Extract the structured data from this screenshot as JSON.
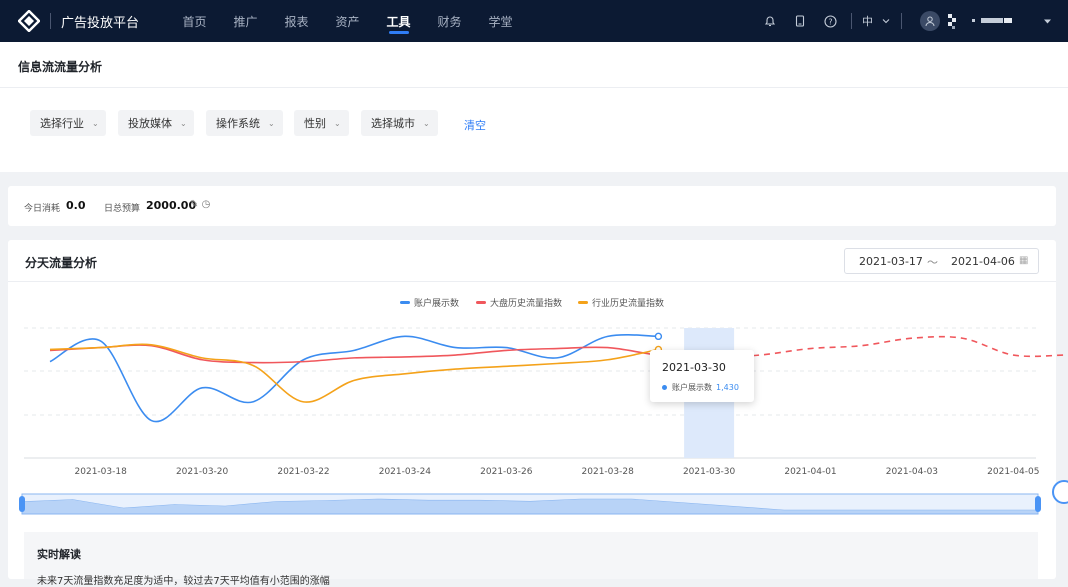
{
  "header": {
    "brand": "广告投放平台",
    "nav": [
      "首页",
      "推广",
      "报表",
      "资产",
      "工具",
      "财务",
      "学堂"
    ],
    "active_nav": "工具",
    "lang": "中",
    "icons": [
      "bell-icon",
      "tablet-icon",
      "help-icon",
      "user-icon",
      "caret-down-icon"
    ]
  },
  "page": {
    "title": "信息流流量分析"
  },
  "filters": {
    "items": [
      "选择行业",
      "投放媒体",
      "操作系统",
      "性别",
      "选择城市"
    ],
    "clear_label": "清空"
  },
  "budget": {
    "today_label": "今日消耗",
    "today_value": "0.0",
    "daily_label": "日总预算",
    "daily_value": "2000.00"
  },
  "card": {
    "title": "分天流量分析",
    "date_start": "2021-03-17",
    "date_sep": "〜",
    "date_end": "2021-04-06"
  },
  "tooltip": {
    "date": "2021-03-30",
    "label": "账户展示数",
    "value": "1,430"
  },
  "insight": {
    "title": "实时解读",
    "text": "未来7天流量指数充足度为适中，较过去7天平均值有小范围的涨幅"
  },
  "colors": {
    "blue": "#3b8cf0",
    "red": "#f0575c",
    "orange": "#f4a21a",
    "accent": "#2f7df6"
  },
  "chart_data": {
    "type": "line",
    "x": [
      "2021-03-17",
      "2021-03-18",
      "2021-03-19",
      "2021-03-20",
      "2021-03-21",
      "2021-03-22",
      "2021-03-23",
      "2021-03-24",
      "2021-03-25",
      "2021-03-26",
      "2021-03-27",
      "2021-03-28",
      "2021-03-29",
      "2021-03-30",
      "2021-03-31",
      "2021-04-01",
      "2021-04-02",
      "2021-04-03",
      "2021-04-04",
      "2021-04-05",
      "2021-04-06"
    ],
    "x_tick_labels": [
      "2021-03-18",
      "2021-03-20",
      "2021-03-22",
      "2021-03-24",
      "2021-03-26",
      "2021-03-28",
      "2021-03-30",
      "2021-04-01",
      "2021-04-03",
      "2021-04-05"
    ],
    "series": [
      {
        "name": "账户展示数",
        "color": "#3b8cf0",
        "values": [
          103,
          125,
          40,
          75,
          60,
          105,
          115,
          130,
          118,
          118,
          107,
          130,
          130,
          null,
          null,
          null,
          null,
          null,
          null,
          null,
          null
        ]
      },
      {
        "name": "大盘历史流量指数",
        "color": "#f0575c",
        "values": [
          115,
          118,
          120,
          105,
          102,
          103,
          107,
          108,
          110,
          115,
          117,
          118,
          110,
          107,
          110,
          117,
          120,
          128,
          128,
          110,
          110
        ],
        "forecast_from": 13
      },
      {
        "name": "行业历史流量指数",
        "color": "#f4a21a",
        "values": [
          116,
          118,
          121,
          107,
          99,
          60,
          83,
          90,
          95,
          98,
          101,
          105,
          116,
          null,
          null,
          null,
          null,
          null,
          null,
          null,
          null
        ]
      }
    ],
    "highlight_index": 13,
    "legend_position": "top-center",
    "grid": true
  }
}
